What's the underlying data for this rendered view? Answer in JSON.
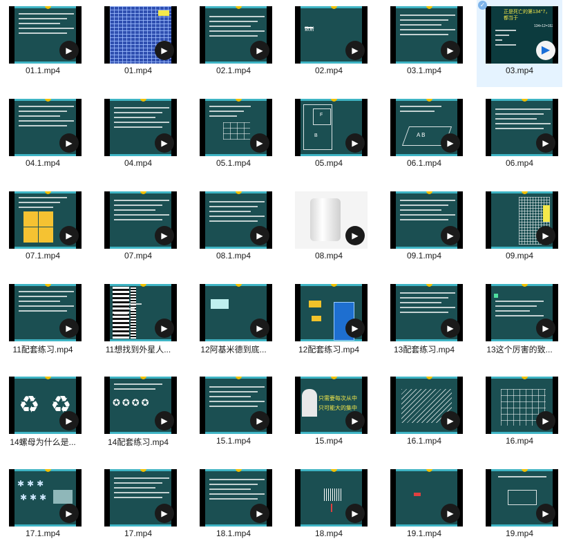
{
  "files": [
    {
      "name": "01.1.mp4"
    },
    {
      "name": "01.mp4"
    },
    {
      "name": "02.1.mp4"
    },
    {
      "name": "02.mp4"
    },
    {
      "name": "03.1.mp4"
    },
    {
      "name": "03.mp4",
      "thumb_text": "正是死亡的第134°7，都当于",
      "thumb_text2": "134+12=152"
    },
    {
      "name": "04.1.mp4"
    },
    {
      "name": "04.mp4"
    },
    {
      "name": "05.1.mp4"
    },
    {
      "name": "05.mp4"
    },
    {
      "name": "06.1.mp4"
    },
    {
      "name": "06.mp4"
    },
    {
      "name": "07.1.mp4"
    },
    {
      "name": "07.mp4"
    },
    {
      "name": "08.1.mp4"
    },
    {
      "name": "08.mp4"
    },
    {
      "name": "09.1.mp4"
    },
    {
      "name": "09.mp4"
    },
    {
      "name": "11配套练习.mp4"
    },
    {
      "name": "11想找到外星人..."
    },
    {
      "name": "12阿基米德到底..."
    },
    {
      "name": "12配套练习.mp4"
    },
    {
      "name": "13配套练习.mp4"
    },
    {
      "name": "13这个厉害的致..."
    },
    {
      "name": "14螺母为什么是..."
    },
    {
      "name": "14配套练习.mp4"
    },
    {
      "name": "15.1.mp4"
    },
    {
      "name": "15.mp4"
    },
    {
      "name": "16.1.mp4"
    },
    {
      "name": "16.mp4"
    },
    {
      "name": "17.1.mp4"
    },
    {
      "name": "17.mp4"
    },
    {
      "name": "18.1.mp4"
    },
    {
      "name": "18.mp4"
    },
    {
      "name": "19.1.mp4"
    },
    {
      "name": "19.mp4"
    }
  ],
  "thumbs": {
    "t1": "数射",
    "t9": "F",
    "t9b": "B",
    "t10": "A  B",
    "t27": "只需要每次从中",
    "t27b": "只可能大的集中"
  },
  "icons": {
    "play": "play-icon",
    "check": "check-icon"
  },
  "colors": {
    "slide_bg": "#1b4f52",
    "accent_bar": "#3fb4c4",
    "selection": "#e5f3ff"
  }
}
